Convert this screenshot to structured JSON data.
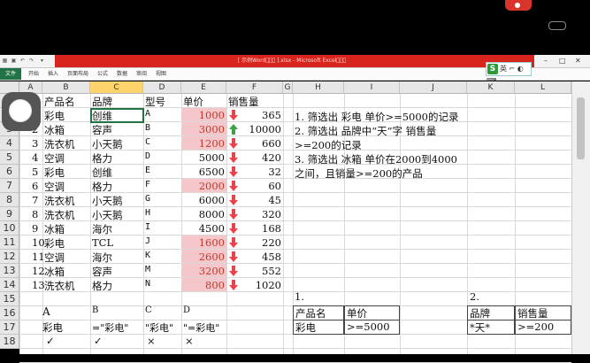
{
  "window": {
    "title": "[ 示例Word\u0000\u0000\u0000 ].xlsx - Microsoft Excel\u0000\u0000\u0000",
    "minimize": "–",
    "restore": "□",
    "close": "✕"
  },
  "ime": {
    "logo": "S",
    "label": "英"
  },
  "ribbon": {
    "tabs": [
      "文件",
      "开始",
      "插入",
      "页面布局",
      "公式",
      "数据",
      "审阅",
      "视图"
    ]
  },
  "columns": [
    "A",
    "B",
    "C",
    "D",
    "E",
    "F",
    "G",
    "H",
    "I",
    "J",
    "K",
    "L"
  ],
  "rows": [
    "1",
    "2",
    "3",
    "4",
    "5",
    "6",
    "7",
    "8",
    "9",
    "10",
    "11",
    "12",
    "13",
    "14",
    "15",
    "16",
    "17",
    "18"
  ],
  "header": {
    "a": "产品名",
    "b": "品牌",
    "c": "型号",
    "d": "单价",
    "e": "销售量"
  },
  "table": [
    {
      "n": "1",
      "name": "彩电",
      "brand": "创维",
      "model": "A",
      "price": "1000",
      "dir": "down",
      "qty": "365",
      "hi": true
    },
    {
      "n": "2",
      "name": "冰箱",
      "brand": "容声",
      "model": "B",
      "price": "3000",
      "dir": "up",
      "qty": "10000",
      "hi": true
    },
    {
      "n": "3",
      "name": "洗衣机",
      "brand": "小天鹅",
      "model": "C",
      "price": "1200",
      "dir": "down",
      "qty": "660",
      "hi": true
    },
    {
      "n": "4",
      "name": "空调",
      "brand": "格力",
      "model": "D",
      "price": "5000",
      "dir": "down",
      "qty": "420",
      "hi": false
    },
    {
      "n": "5",
      "name": "彩电",
      "brand": "创维",
      "model": "E",
      "price": "6500",
      "dir": "down",
      "qty": "32",
      "hi": false
    },
    {
      "n": "6",
      "name": "空调",
      "brand": "格力",
      "model": "F",
      "price": "2000",
      "dir": "down",
      "qty": "60",
      "hi": true
    },
    {
      "n": "7",
      "name": "洗衣机",
      "brand": "小天鹅",
      "model": "G",
      "price": "6000",
      "dir": "down",
      "qty": "45",
      "hi": false
    },
    {
      "n": "8",
      "name": "洗衣机",
      "brand": "小天鹅",
      "model": "H",
      "price": "8000",
      "dir": "down",
      "qty": "320",
      "hi": false
    },
    {
      "n": "9",
      "name": "冰箱",
      "brand": "海尔",
      "model": "I",
      "price": "4500",
      "dir": "down",
      "qty": "168",
      "hi": false
    },
    {
      "n": "10",
      "name": "彩电",
      "brand": "TCL",
      "model": "J",
      "price": "1600",
      "dir": "down",
      "qty": "220",
      "hi": true
    },
    {
      "n": "11",
      "name": "空调",
      "brand": "海尔",
      "model": "K",
      "price": "2600",
      "dir": "down",
      "qty": "458",
      "hi": true
    },
    {
      "n": "12",
      "name": "冰箱",
      "brand": "容声",
      "model": "M",
      "price": "3200",
      "dir": "down",
      "qty": "552",
      "hi": true
    },
    {
      "n": "13",
      "name": "洗衣机",
      "brand": "格力",
      "model": "N",
      "price": "800",
      "dir": "down",
      "qty": "1020",
      "hi": true
    }
  ],
  "notes": [
    "1. 筛选出 彩电 单价>=5000的记录",
    "2. 筛选出 品牌中“天”字 销售量",
    ">=200的记录",
    "3. 筛选出 冰箱 单价在2000到4000",
    "之间，且销量>=200的产品"
  ],
  "criteria1": {
    "label": "1.",
    "h1": "产品名",
    "h2": "单价",
    "v1": "彩电",
    "v2": ">=5000"
  },
  "criteria2": {
    "label": "2.",
    "h1": "品牌",
    "h2": "销售量",
    "v1": "*天*",
    "v2": ">=200"
  },
  "bottom": {
    "a16": "A",
    "b16": "B",
    "c16": "C",
    "d16": "D",
    "a17": "彩电",
    "b17": "=\"彩电\"",
    "c17": "\"彩电\"",
    "d17": "\"=彩电\"",
    "a18": "✓",
    "b18": "✓",
    "c18": "×",
    "d18": "×"
  },
  "colors": {
    "excel_green": "#217346",
    "title_red": "#d8241c",
    "highlight_pink": "#f5c6ca",
    "arrow_red": "#e8434a",
    "arrow_green": "#3aa34a"
  }
}
